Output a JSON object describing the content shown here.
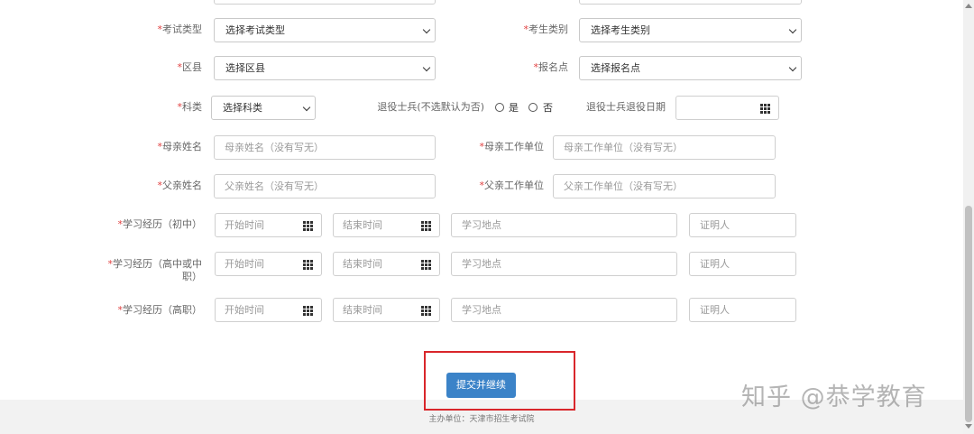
{
  "form": {
    "exam_type": {
      "label": "考试类型",
      "value": "选择考试类型"
    },
    "candidate_category": {
      "label": "考生类别",
      "value": "选择考生类别"
    },
    "district": {
      "label": "区县",
      "value": "选择区县"
    },
    "registration_point": {
      "label": "报名点",
      "value": "选择报名点"
    },
    "subject": {
      "label": "科类",
      "value": "选择科类"
    },
    "veteran": {
      "label": "退役士兵(不选默认为否)",
      "yes": "是",
      "no": "否"
    },
    "veteran_date": {
      "label": "退役士兵退役日期",
      "value": ""
    },
    "mother_name": {
      "label": "母亲姓名",
      "placeholder": "母亲姓名（没有写无）"
    },
    "mother_work": {
      "label": "母亲工作单位",
      "placeholder": "母亲工作单位（没有写无）"
    },
    "father_name": {
      "label": "父亲姓名",
      "placeholder": "父亲姓名（没有写无）"
    },
    "father_work": {
      "label": "父亲工作单位",
      "placeholder": "父亲工作单位（没有写无）"
    },
    "education": {
      "start_placeholder": "开始时间",
      "end_placeholder": "结束时间",
      "place_placeholder": "学习地点",
      "witness_placeholder": "证明人",
      "rows": [
        {
          "label": "学习经历（初中）"
        },
        {
          "label_line1": "学习经历（高中或中",
          "label_line2": "职）"
        },
        {
          "label": "学习经历（高职）"
        }
      ]
    },
    "required_mark": "*",
    "submit_label": "提交并继续"
  },
  "footer": {
    "text": "主办单位：天津市招生考试院"
  },
  "watermark": "知乎 @恭学教育",
  "colors": {
    "accent": "#3b83c8",
    "required": "#e04040",
    "highlight": "#d9262b"
  },
  "icons": {
    "calendar": "calendar-grid-icon",
    "dropdown": "chevron-down-icon"
  }
}
